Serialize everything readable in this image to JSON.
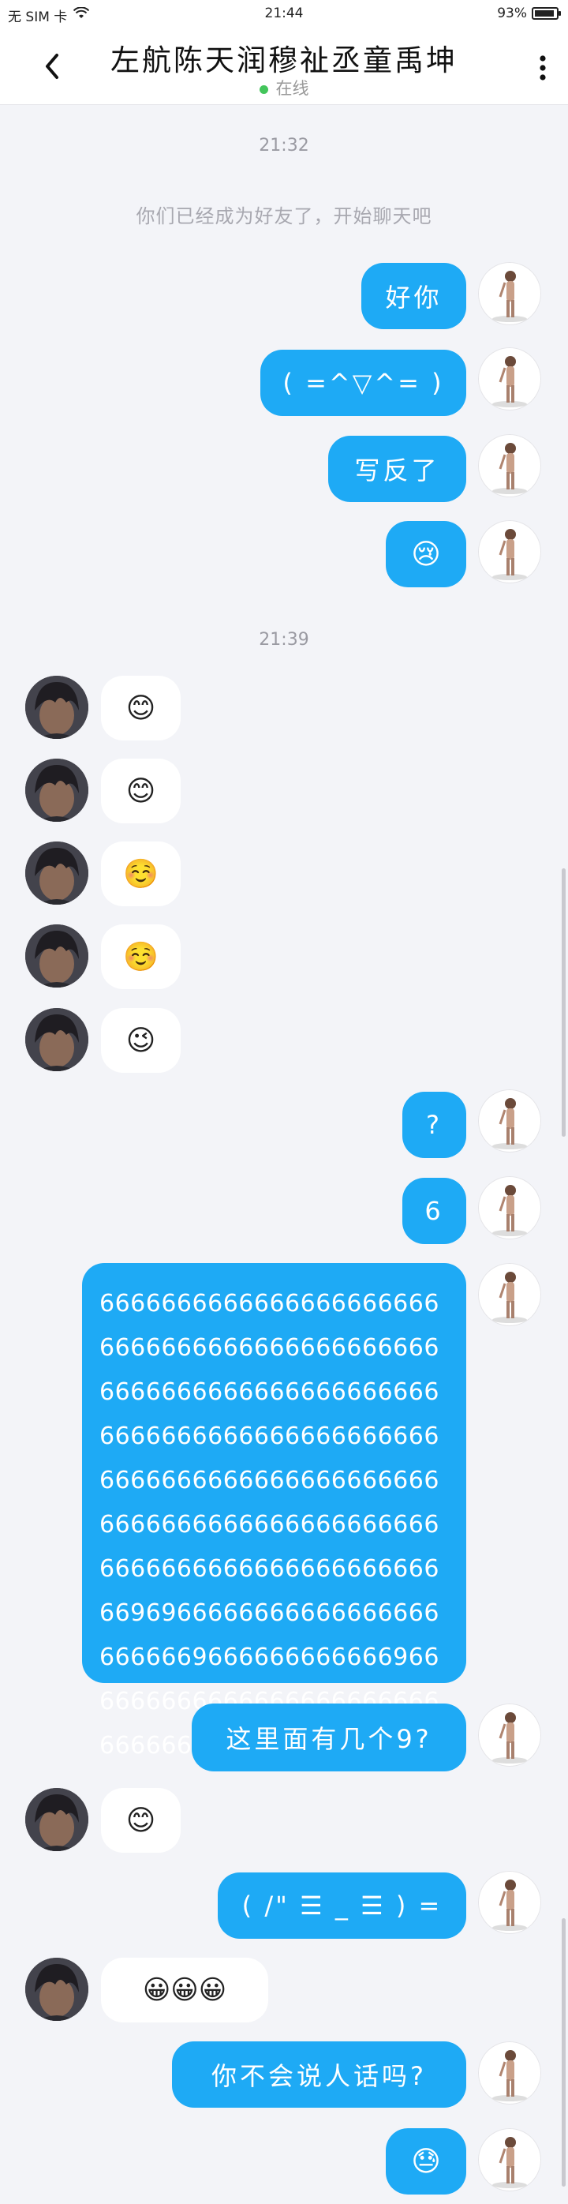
{
  "status_bar": {
    "carrier": "无 SIM 卡",
    "time": "21:44",
    "battery_text": "93%",
    "battery_level": 0.93
  },
  "header": {
    "title": "左航陈天润穆祉丞童禹坤",
    "status": "在线"
  },
  "messages": [
    {
      "kind": "time",
      "text": "21:32"
    },
    {
      "kind": "system",
      "text": "你们已经成为好友了，开始聊天吧"
    },
    {
      "kind": "sent",
      "text": "好你"
    },
    {
      "kind": "sent",
      "text": "( =^▽^= )"
    },
    {
      "kind": "sent",
      "text": "写反了"
    },
    {
      "kind": "sent",
      "text": "😢"
    },
    {
      "kind": "time",
      "text": "21:39"
    },
    {
      "kind": "recv",
      "text": "😊"
    },
    {
      "kind": "recv",
      "text": "😊"
    },
    {
      "kind": "recv",
      "text": "☺️"
    },
    {
      "kind": "recv",
      "text": "☺️"
    },
    {
      "kind": "recv",
      "text": "😉"
    },
    {
      "kind": "sent",
      "text": "?"
    },
    {
      "kind": "sent",
      "text": "6"
    },
    {
      "kind": "sent",
      "text": "666666666666666666666666666666666666666666666666666666666666666666666666666666666666666666666666666666666666666666666666666666666666666666666666666666666666969666666666666666666666669666666666666966666666666666666666666666666669666666666"
    },
    {
      "kind": "sent",
      "text": "这里面有几个9?"
    },
    {
      "kind": "recv",
      "text": "😊"
    },
    {
      "kind": "sent",
      "text": "( /\" ☰ _ ☰ ) ="
    },
    {
      "kind": "recv",
      "text": "😀😀😀"
    },
    {
      "kind": "sent",
      "text": "你不会说人话吗?"
    },
    {
      "kind": "sent",
      "text": "😓"
    }
  ],
  "colors": {
    "sent_bubble": "#1eaaf5",
    "recv_bubble": "#ffffff",
    "background": "#f3f4f8",
    "online_dot": "#43c55b"
  }
}
